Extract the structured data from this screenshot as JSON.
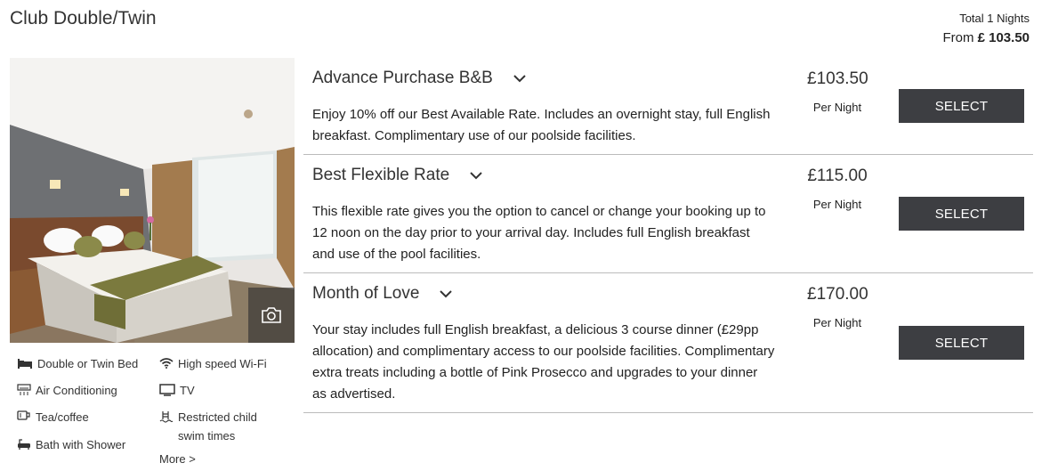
{
  "room": {
    "title": "Club Double/Twin"
  },
  "summary": {
    "total_label": "Total",
    "nights_count": "1",
    "nights_label": "Nights",
    "from_label": "From",
    "from_price": "£ 103.50"
  },
  "amenities": [
    {
      "label": "Double or Twin Bed",
      "icon": "bed-icon"
    },
    {
      "label": "High speed Wi-Fi",
      "icon": "wifi-icon"
    },
    {
      "label": "Air Conditioning",
      "icon": "air-conditioning-icon"
    },
    {
      "label": "TV",
      "icon": "tv-icon"
    },
    {
      "label": "Tea/coffee",
      "icon": "tea-coffee-icon"
    },
    {
      "label": "Restricted child swim times",
      "icon": "pool-icon"
    },
    {
      "label": "Bath with Shower",
      "icon": "bath-icon"
    }
  ],
  "more_label": "More >",
  "rates": [
    {
      "name": "Advance Purchase B&B",
      "description": "Enjoy 10% off our Best Available Rate. Includes an overnight stay, full English breakfast. Complimentary use of our poolside facilities.",
      "price": "£103.50",
      "per": "Per Night",
      "button": "SELECT"
    },
    {
      "name": "Best Flexible Rate",
      "description": "This flexible rate gives you the option to cancel or change your booking up to 12 noon on the day prior to your arrival day. Includes full English breakfast and use of the pool facilities.",
      "price": "£115.00",
      "per": "Per Night",
      "button": "SELECT"
    },
    {
      "name": "Month of Love",
      "description": "Your stay includes full English breakfast, a delicious 3 course dinner (£29pp allocation) and complimentary access to our poolside facilities. Complimentary extra treats including a bottle of Pink Prosecco and upgrades to your dinner as advertised.",
      "price": "£170.00",
      "per": "Per Night",
      "button": "SELECT"
    }
  ],
  "colors": {
    "button_bg": "#3d3e42",
    "divider": "#bbbbbb"
  }
}
